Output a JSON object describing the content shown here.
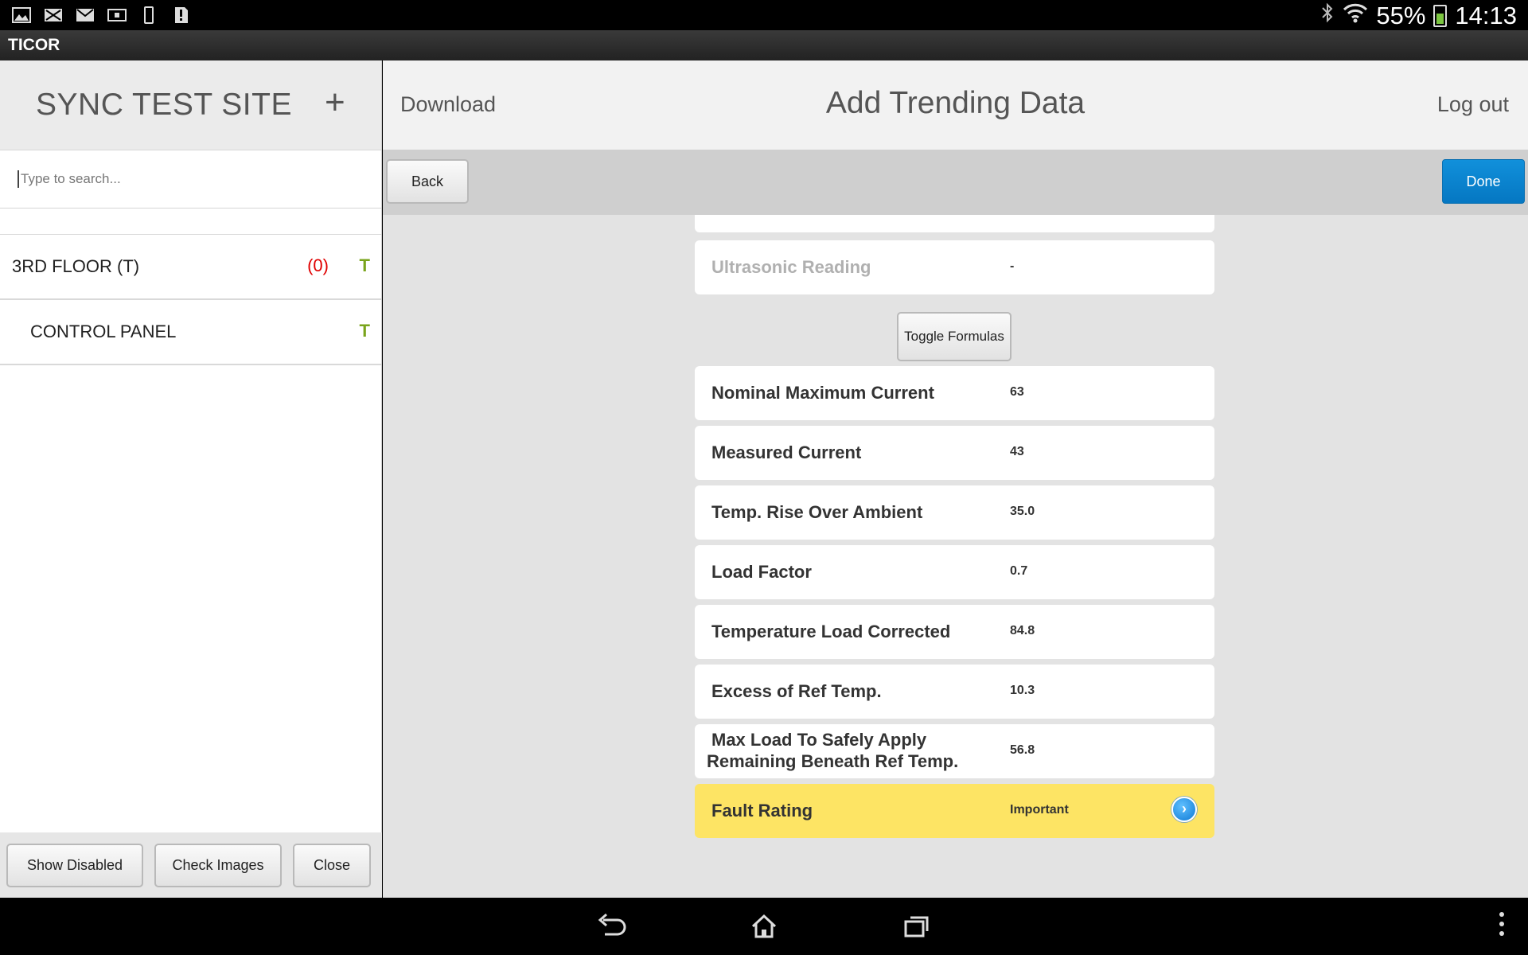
{
  "status_bar": {
    "battery_percent": "55%",
    "time": "14:13",
    "notification_icons": [
      "image-icon",
      "mail-x-icon",
      "mail-icon",
      "card-icon",
      "phone-icon",
      "sd-alert-icon"
    ]
  },
  "app": {
    "title": "TICOR"
  },
  "sidebar": {
    "site_title": "SYNC TEST SITE",
    "add_label": "+",
    "search_placeholder": "Type to search...",
    "items": [
      {
        "label": "3RD FLOOR (T)",
        "count": "(0)",
        "flag": "T"
      },
      {
        "label": "CONTROL PANEL",
        "flag": "T"
      }
    ],
    "footer": {
      "show_disabled": "Show Disabled",
      "check_images": "Check Images",
      "close": "Close"
    }
  },
  "header": {
    "download": "Download",
    "title": "Add Trending Data",
    "logout": "Log out"
  },
  "toolbar": {
    "back": "Back",
    "done": "Done"
  },
  "form": {
    "ultrasonic": {
      "label": "Ultrasonic Reading",
      "value": "-"
    },
    "toggle_formulas": "Toggle Formulas",
    "fields": [
      {
        "label": "Nominal Maximum Current",
        "value": "63"
      },
      {
        "label": "Measured Current",
        "value": "43"
      },
      {
        "label": "Temp. Rise Over Ambient",
        "value": "35.0"
      },
      {
        "label": "Load Factor",
        "value": "0.7"
      },
      {
        "label": "Temperature Load Corrected",
        "value": "84.8"
      },
      {
        "label": "Excess of Ref Temp.",
        "value": "10.3"
      },
      {
        "label_line1": "Max Load To Safely Apply",
        "label_line2": "Remaining Beneath Ref Temp.",
        "value": "56.8"
      }
    ],
    "fault": {
      "label": "Fault Rating",
      "value": "Important"
    }
  },
  "colors": {
    "accent_blue": "#0577c2",
    "fault_yellow": "#fde464",
    "count_red": "#e00000",
    "flag_green": "#7aa41c"
  }
}
